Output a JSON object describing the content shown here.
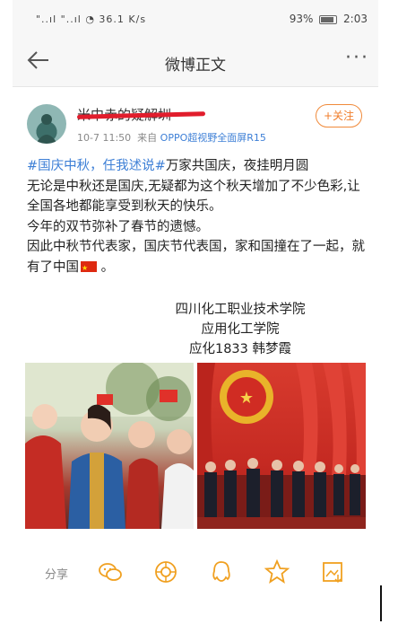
{
  "status_bar": {
    "signal": "\"..ıl \"..ıl ◔ 36.1 K/s",
    "battery": "93%",
    "time": "2:03"
  },
  "header": {
    "title": "微博正文"
  },
  "post": {
    "username": "米中赤的疑解圳",
    "timestamp": "10-7 11:50",
    "source_prefix": "来自",
    "source": "OPPO超视野全面屏R15",
    "follow_label": "+关注",
    "hashtag": "#国庆中秋，任我述说#",
    "line1_rest": "万家共国庆，夜挂明月圆",
    "line2": "无论是中秋还是国庆,无疑都为这个秋天增加了不少色彩,让全国各地都能享受到秋天的快乐。",
    "line3": "今年的双节弥补了春节的遗憾。",
    "line4_a": "因此中秋节代表家，国庆节代表国，家和国撞在了一起，就有了中国",
    "line4_b": "。",
    "sign_school": "四川化工职业技术学院",
    "sign_college": "应用化工学院",
    "sign_class": "应化1833 韩梦霞"
  },
  "actions": {
    "share_label": "分享"
  },
  "colors": {
    "link": "#3d7fd6",
    "follow": "#f07d2a",
    "icon": "#f0a020",
    "redact": "#e11d2c"
  }
}
